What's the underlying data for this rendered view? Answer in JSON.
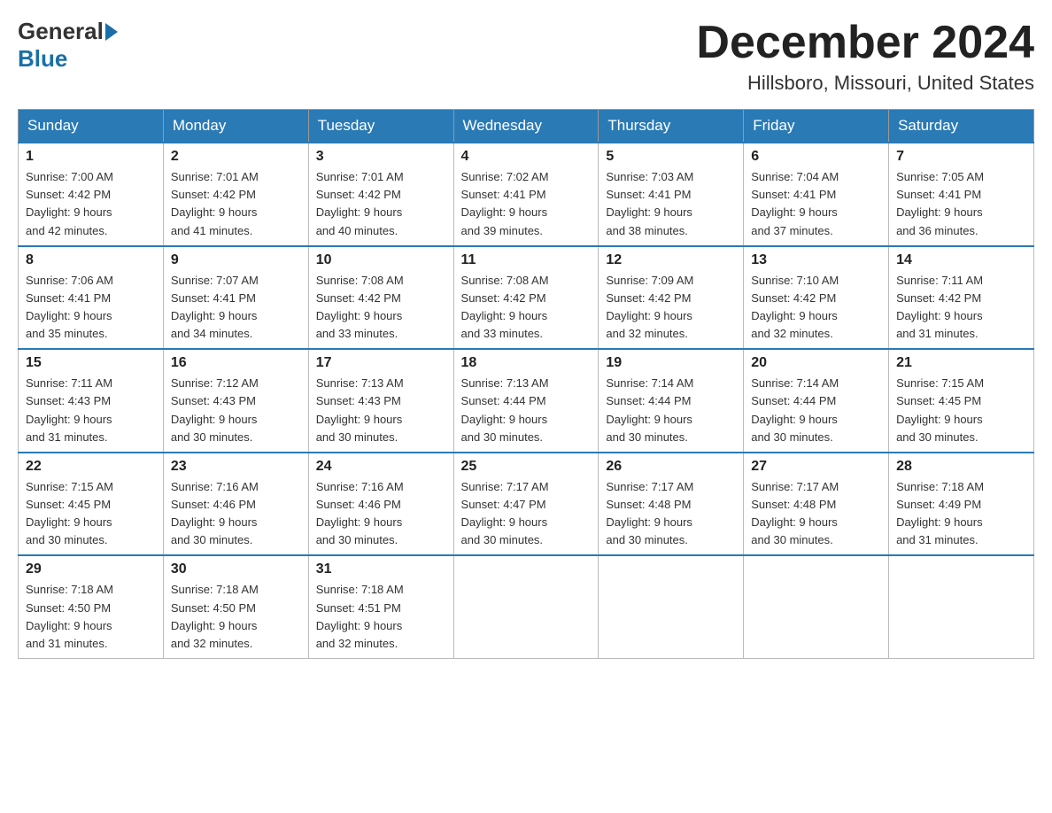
{
  "header": {
    "logo_general": "General",
    "logo_blue": "Blue",
    "month_title": "December 2024",
    "location": "Hillsboro, Missouri, United States"
  },
  "weekdays": [
    "Sunday",
    "Monday",
    "Tuesday",
    "Wednesday",
    "Thursday",
    "Friday",
    "Saturday"
  ],
  "weeks": [
    [
      {
        "day": "1",
        "sunrise": "7:00 AM",
        "sunset": "4:42 PM",
        "daylight": "9 hours and 42 minutes."
      },
      {
        "day": "2",
        "sunrise": "7:01 AM",
        "sunset": "4:42 PM",
        "daylight": "9 hours and 41 minutes."
      },
      {
        "day": "3",
        "sunrise": "7:01 AM",
        "sunset": "4:42 PM",
        "daylight": "9 hours and 40 minutes."
      },
      {
        "day": "4",
        "sunrise": "7:02 AM",
        "sunset": "4:41 PM",
        "daylight": "9 hours and 39 minutes."
      },
      {
        "day": "5",
        "sunrise": "7:03 AM",
        "sunset": "4:41 PM",
        "daylight": "9 hours and 38 minutes."
      },
      {
        "day": "6",
        "sunrise": "7:04 AM",
        "sunset": "4:41 PM",
        "daylight": "9 hours and 37 minutes."
      },
      {
        "day": "7",
        "sunrise": "7:05 AM",
        "sunset": "4:41 PM",
        "daylight": "9 hours and 36 minutes."
      }
    ],
    [
      {
        "day": "8",
        "sunrise": "7:06 AM",
        "sunset": "4:41 PM",
        "daylight": "9 hours and 35 minutes."
      },
      {
        "day": "9",
        "sunrise": "7:07 AM",
        "sunset": "4:41 PM",
        "daylight": "9 hours and 34 minutes."
      },
      {
        "day": "10",
        "sunrise": "7:08 AM",
        "sunset": "4:42 PM",
        "daylight": "9 hours and 33 minutes."
      },
      {
        "day": "11",
        "sunrise": "7:08 AM",
        "sunset": "4:42 PM",
        "daylight": "9 hours and 33 minutes."
      },
      {
        "day": "12",
        "sunrise": "7:09 AM",
        "sunset": "4:42 PM",
        "daylight": "9 hours and 32 minutes."
      },
      {
        "day": "13",
        "sunrise": "7:10 AM",
        "sunset": "4:42 PM",
        "daylight": "9 hours and 32 minutes."
      },
      {
        "day": "14",
        "sunrise": "7:11 AM",
        "sunset": "4:42 PM",
        "daylight": "9 hours and 31 minutes."
      }
    ],
    [
      {
        "day": "15",
        "sunrise": "7:11 AM",
        "sunset": "4:43 PM",
        "daylight": "9 hours and 31 minutes."
      },
      {
        "day": "16",
        "sunrise": "7:12 AM",
        "sunset": "4:43 PM",
        "daylight": "9 hours and 30 minutes."
      },
      {
        "day": "17",
        "sunrise": "7:13 AM",
        "sunset": "4:43 PM",
        "daylight": "9 hours and 30 minutes."
      },
      {
        "day": "18",
        "sunrise": "7:13 AM",
        "sunset": "4:44 PM",
        "daylight": "9 hours and 30 minutes."
      },
      {
        "day": "19",
        "sunrise": "7:14 AM",
        "sunset": "4:44 PM",
        "daylight": "9 hours and 30 minutes."
      },
      {
        "day": "20",
        "sunrise": "7:14 AM",
        "sunset": "4:44 PM",
        "daylight": "9 hours and 30 minutes."
      },
      {
        "day": "21",
        "sunrise": "7:15 AM",
        "sunset": "4:45 PM",
        "daylight": "9 hours and 30 minutes."
      }
    ],
    [
      {
        "day": "22",
        "sunrise": "7:15 AM",
        "sunset": "4:45 PM",
        "daylight": "9 hours and 30 minutes."
      },
      {
        "day": "23",
        "sunrise": "7:16 AM",
        "sunset": "4:46 PM",
        "daylight": "9 hours and 30 minutes."
      },
      {
        "day": "24",
        "sunrise": "7:16 AM",
        "sunset": "4:46 PM",
        "daylight": "9 hours and 30 minutes."
      },
      {
        "day": "25",
        "sunrise": "7:17 AM",
        "sunset": "4:47 PM",
        "daylight": "9 hours and 30 minutes."
      },
      {
        "day": "26",
        "sunrise": "7:17 AM",
        "sunset": "4:48 PM",
        "daylight": "9 hours and 30 minutes."
      },
      {
        "day": "27",
        "sunrise": "7:17 AM",
        "sunset": "4:48 PM",
        "daylight": "9 hours and 30 minutes."
      },
      {
        "day": "28",
        "sunrise": "7:18 AM",
        "sunset": "4:49 PM",
        "daylight": "9 hours and 31 minutes."
      }
    ],
    [
      {
        "day": "29",
        "sunrise": "7:18 AM",
        "sunset": "4:50 PM",
        "daylight": "9 hours and 31 minutes."
      },
      {
        "day": "30",
        "sunrise": "7:18 AM",
        "sunset": "4:50 PM",
        "daylight": "9 hours and 32 minutes."
      },
      {
        "day": "31",
        "sunrise": "7:18 AM",
        "sunset": "4:51 PM",
        "daylight": "9 hours and 32 minutes."
      },
      null,
      null,
      null,
      null
    ]
  ],
  "labels": {
    "sunrise": "Sunrise:",
    "sunset": "Sunset:",
    "daylight": "Daylight:"
  }
}
